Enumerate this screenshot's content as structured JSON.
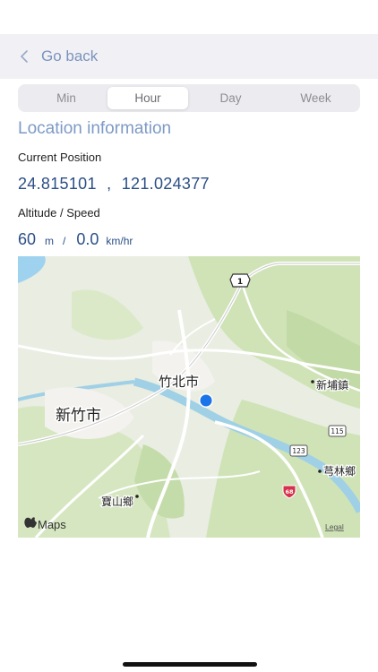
{
  "nav": {
    "back_label": "Go back"
  },
  "segments": [
    "Min",
    "Hour",
    "Day",
    "Week"
  ],
  "selected_segment": "Hour",
  "section_title": "Location information",
  "current_position": {
    "label": "Current Position",
    "latitude": "24.815101",
    "separator": ",",
    "longitude": "121.024377"
  },
  "altitude_speed": {
    "label": "Altitude / Speed",
    "altitude": "60",
    "altitude_unit": "m",
    "separator": "/",
    "speed": "0.0",
    "speed_unit": "km/hr"
  },
  "map": {
    "labels": {
      "zhubei": "竹北市",
      "hsinchu": "新竹市",
      "xinpu": "新埔鎮",
      "qionglin": "芎林鄉",
      "baoshan": "寶山鄉"
    },
    "shields": {
      "r1": "1",
      "r115": "115",
      "r123": "123",
      "r68": "68"
    },
    "attribution": "Maps",
    "legal": "Legal"
  },
  "colors": {
    "accent": "#7d9ac6",
    "value_text": "#2b4f86",
    "location_dot": "#1a73e8"
  }
}
